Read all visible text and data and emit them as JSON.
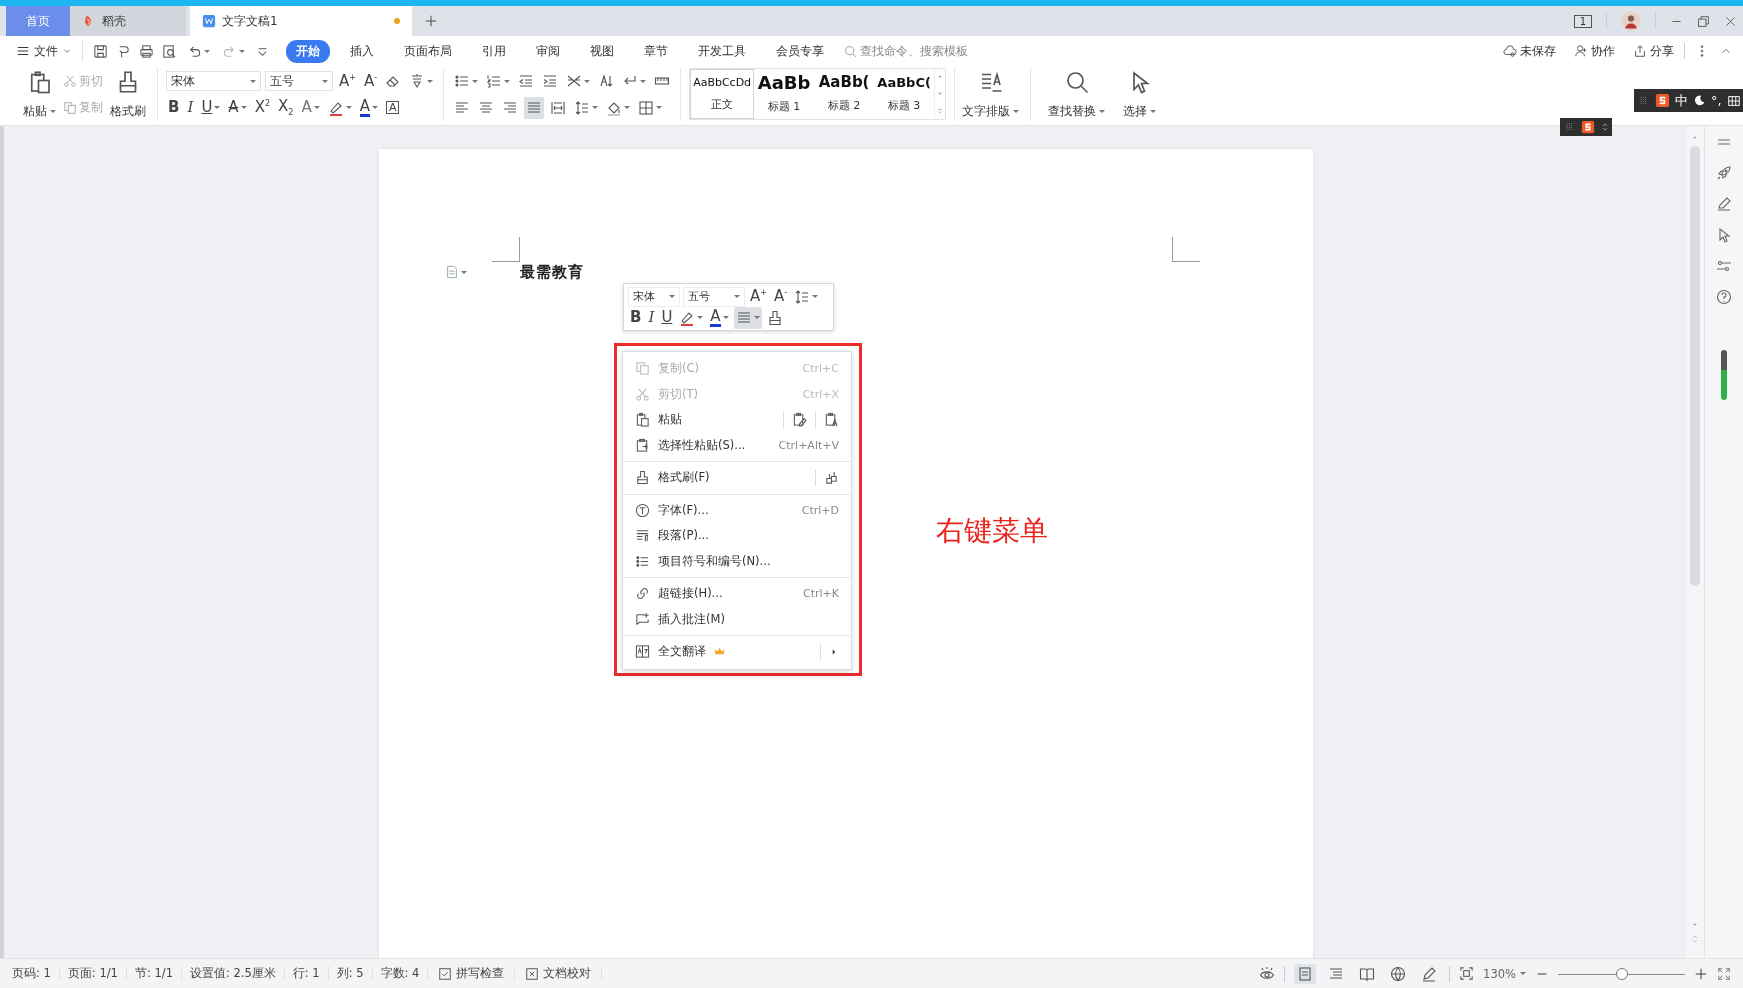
{
  "window": {
    "tabs": [
      {
        "label": "首页",
        "kind": "home",
        "selected": false
      },
      {
        "label": "稻壳",
        "kind": "store",
        "selected": false
      },
      {
        "label": "文字文稿1",
        "kind": "document",
        "selected": true,
        "unsaved": true
      }
    ],
    "window_count": "1"
  },
  "menu_bar": {
    "file": "文件",
    "tabs": [
      {
        "label": "开始",
        "selected": true
      },
      {
        "label": "插入",
        "selected": false
      },
      {
        "label": "页面布局",
        "selected": false
      },
      {
        "label": "引用",
        "selected": false
      },
      {
        "label": "审阅",
        "selected": false
      },
      {
        "label": "视图",
        "selected": false
      },
      {
        "label": "章节",
        "selected": false
      },
      {
        "label": "开发工具",
        "selected": false
      },
      {
        "label": "会员专享",
        "selected": false
      }
    ],
    "search": {
      "placeholder": "查找命令、搜索模板"
    },
    "actions": [
      {
        "label": "未保存",
        "kind": "cloud"
      },
      {
        "label": "协作",
        "kind": "person"
      },
      {
        "label": "分享",
        "kind": "share"
      }
    ]
  },
  "ribbon": {
    "clipboard": {
      "paste": "粘贴",
      "cut": "剪切",
      "copy": "复制",
      "format_painter": "格式刷"
    },
    "font": "宋体",
    "size": "五号",
    "font_tools": [
      {
        "kind": "grow",
        "glyph": "A$^{+}$"
      },
      {
        "kind": "shrink",
        "glyph": "A$^{-}$"
      },
      {
        "kind": "clear"
      },
      {
        "kind": "pinyin",
        "dropdown": true
      }
    ],
    "format_tools": [
      {
        "kind": "bold",
        "glyph": "B"
      },
      {
        "kind": "italic",
        "glyph": "I"
      },
      {
        "kind": "underline",
        "glyph": "U",
        "dropdown": true
      },
      {
        "kind": "strike",
        "glyph": "A",
        "dropdown": true
      },
      {
        "kind": "sup",
        "glyph": "X$^{2}$"
      },
      {
        "kind": "sub",
        "glyph": "X$_{2}$"
      },
      {
        "kind": "outline",
        "glyph": "A",
        "dropdown": true
      },
      {
        "kind": "highlight",
        "dropdown": true
      },
      {
        "kind": "color",
        "glyph": "A",
        "dropdown": true
      },
      {
        "kind": "boxed",
        "glyph": "A"
      }
    ],
    "paragraph_tools": [
      {
        "kind": "bullets",
        "dropdown": true
      },
      {
        "kind": "numbering",
        "dropdown": true
      },
      {
        "kind": "indent-dec"
      },
      {
        "kind": "indent-inc"
      },
      {
        "kind": "cn-layout",
        "dropdown": true
      },
      {
        "kind": "sort"
      },
      {
        "kind": "marks",
        "dropdown": true
      },
      {
        "kind": "ruler"
      }
    ],
    "align_tools": [
      {
        "kind": "align-left",
        "selected": false
      },
      {
        "kind": "align-center",
        "selected": false
      },
      {
        "kind": "align-right",
        "selected": false
      },
      {
        "kind": "align-justify",
        "selected": true
      },
      {
        "kind": "distribute",
        "selected": false
      }
    ],
    "paragraph_tools_2": [
      {
        "kind": "line-spacing",
        "dropdown": true
      },
      {
        "kind": "shading",
        "dropdown": true
      },
      {
        "kind": "borders",
        "dropdown": true
      }
    ],
    "styles": [
      {
        "preview": "AaBbCcDd",
        "label": "正文",
        "kind": "body"
      },
      {
        "preview": "AaBb",
        "label": "标题 1",
        "kind": "h1"
      },
      {
        "preview": "AaBb(",
        "label": "标题 2",
        "kind": "h2"
      },
      {
        "preview": "AaBbC(",
        "label": "标题 3",
        "kind": "h3"
      }
    ],
    "tools": [
      {
        "label": "文字排版",
        "kind": "text-layout"
      },
      {
        "label": "查找替换",
        "kind": "search"
      },
      {
        "label": "选择",
        "kind": "cursor"
      }
    ]
  },
  "ime": {
    "mode": "中",
    "punct": "°,"
  },
  "document": {
    "text": "最需教育"
  },
  "mini_toolbar": {
    "font": "宋体",
    "size": "五号",
    "row_1": [
      {
        "kind": "grow",
        "glyph": "A$^{+}$"
      },
      {
        "kind": "shrink",
        "glyph": "A$^{-}$"
      },
      {
        "kind": "line-spacing",
        "dropdown": true
      }
    ],
    "row_2": [
      {
        "kind": "bold",
        "glyph": "B",
        "active": false
      },
      {
        "kind": "italic",
        "glyph": "I",
        "active": false
      },
      {
        "kind": "underline",
        "glyph": "U",
        "active": false
      },
      {
        "kind": "highlight",
        "dropdown": true,
        "active": false
      },
      {
        "kind": "color",
        "glyph": "A",
        "dropdown": true,
        "active": false
      },
      {
        "kind": "align",
        "dropdown": true,
        "active": true
      },
      {
        "kind": "brush",
        "active": false
      }
    ]
  },
  "context_menu": {
    "groups": [
      [
        {
          "label": "复制(C)",
          "shortcut": "Ctrl+C",
          "kind": "copy",
          "disabled": true
        },
        {
          "label": "剪切(T)",
          "shortcut": "Ctrl+X",
          "kind": "cut",
          "disabled": true
        },
        {
          "label": "粘贴",
          "kind": "paste",
          "disabled": false
        },
        {
          "label": "选择性粘贴(S)...",
          "shortcut": "Ctrl+Alt+V",
          "kind": "paste-special",
          "disabled": false
        }
      ],
      [
        {
          "label": "格式刷(F)",
          "kind": "brush",
          "disabled": false
        }
      ],
      [
        {
          "label": "字体(F)...",
          "shortcut": "Ctrl+D",
          "kind": "font",
          "disabled": false
        },
        {
          "label": "段落(P)...",
          "kind": "paragraph",
          "disabled": false
        },
        {
          "label": "项目符号和编号(N)...",
          "kind": "bullets",
          "disabled": false
        }
      ],
      [
        {
          "label": "超链接(H)...",
          "shortcut": "Ctrl+K",
          "kind": "link",
          "disabled": false
        },
        {
          "label": "插入批注(M)",
          "kind": "comment",
          "disabled": false
        }
      ],
      [
        {
          "label": "全文翻译",
          "kind": "translate",
          "disabled": false,
          "premium": true,
          "submenu": true
        }
      ]
    ]
  },
  "annotation": "右键菜单",
  "status_bar": {
    "items": [
      "页码: 1",
      "页面: 1/1",
      "节: 1/1",
      "设置值: 2.5厘米",
      "行: 1",
      "列: 5",
      "字数: 4"
    ],
    "checks": [
      {
        "label": "拼写检查",
        "kind": "check-box"
      },
      {
        "label": "文档校对",
        "kind": "cross-box"
      }
    ],
    "views": [
      {
        "kind": "page",
        "selected": true
      },
      {
        "kind": "outline",
        "selected": false
      },
      {
        "kind": "book",
        "selected": false
      },
      {
        "kind": "globe",
        "selected": false
      },
      {
        "kind": "pen",
        "selected": false
      }
    ],
    "zoom": "130%",
    "zoom_slider": {
      "level": 0.5
    }
  }
}
